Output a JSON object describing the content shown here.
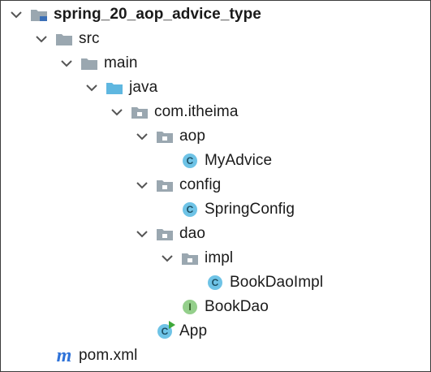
{
  "tree": {
    "nodes": [
      {
        "id": "root",
        "label": "spring_20_aop_advice_type",
        "depth": 0,
        "chevron": true,
        "icon": "module-folder-icon",
        "bold": true
      },
      {
        "id": "src",
        "label": "src",
        "depth": 1,
        "chevron": true,
        "icon": "folder-icon"
      },
      {
        "id": "main",
        "label": "main",
        "depth": 2,
        "chevron": true,
        "icon": "folder-icon"
      },
      {
        "id": "java",
        "label": "java",
        "depth": 3,
        "chevron": true,
        "icon": "source-folder-icon"
      },
      {
        "id": "pkg",
        "label": "com.itheima",
        "depth": 4,
        "chevron": true,
        "icon": "package-icon"
      },
      {
        "id": "aop",
        "label": "aop",
        "depth": 5,
        "chevron": true,
        "icon": "package-icon"
      },
      {
        "id": "myadvice",
        "label": "MyAdvice",
        "depth": 6,
        "chevron": false,
        "icon": "class-icon"
      },
      {
        "id": "config",
        "label": "config",
        "depth": 5,
        "chevron": true,
        "icon": "package-icon"
      },
      {
        "id": "springconfig",
        "label": "SpringConfig",
        "depth": 6,
        "chevron": false,
        "icon": "class-icon"
      },
      {
        "id": "dao",
        "label": "dao",
        "depth": 5,
        "chevron": true,
        "icon": "package-icon"
      },
      {
        "id": "impl",
        "label": "impl",
        "depth": 6,
        "chevron": true,
        "icon": "package-icon"
      },
      {
        "id": "bookdaoimpl",
        "label": "BookDaoImpl",
        "depth": 7,
        "chevron": false,
        "icon": "class-icon"
      },
      {
        "id": "bookdao",
        "label": "BookDao",
        "depth": 6,
        "chevron": false,
        "icon": "interface-icon"
      },
      {
        "id": "app",
        "label": "App",
        "depth": 5,
        "chevron": false,
        "icon": "main-class-icon"
      },
      {
        "id": "pom",
        "label": "pom.xml",
        "depth": 1,
        "chevron": false,
        "icon": "maven-icon"
      }
    ],
    "icon_glyphs": {
      "class": "C",
      "interface": "I",
      "maven": "m"
    }
  },
  "colors": {
    "folder": "#9aa7b0",
    "source_folder": "#5fb7e0",
    "class_fill": "#6ec3e6",
    "class_text": "#1d4f63",
    "interface_fill": "#94cf8b",
    "interface_text": "#2d5a22",
    "run_arrow": "#3fa83a",
    "maven": "#2f73d9",
    "chevron": "#555555"
  }
}
